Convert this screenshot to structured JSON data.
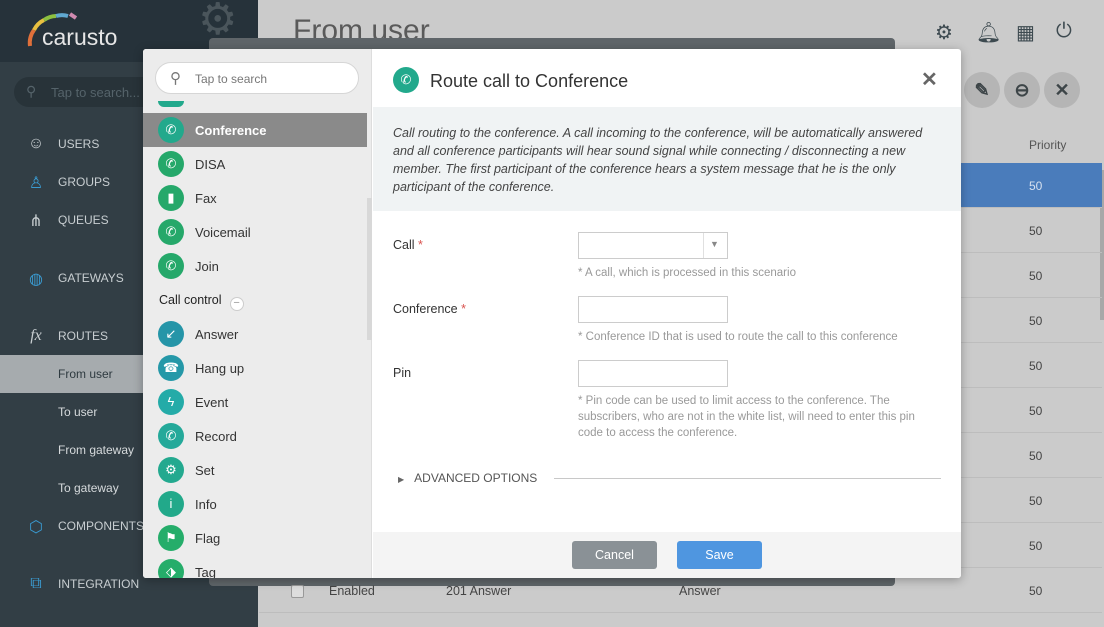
{
  "sidebar": {
    "logo": "carusto",
    "search_placeholder": "Tap to search...",
    "items": [
      {
        "label": "USERS",
        "icon": "user-icon"
      },
      {
        "label": "GROUPS",
        "icon": "groups-icon"
      },
      {
        "label": "QUEUES",
        "icon": "queues-icon"
      },
      {
        "label": "GATEWAYS",
        "icon": "globe-icon"
      },
      {
        "label": "ROUTES",
        "icon": "fx-icon"
      },
      {
        "label": "From user"
      },
      {
        "label": "To user"
      },
      {
        "label": "From gateway"
      },
      {
        "label": "To gateway"
      },
      {
        "label": "COMPONENTS",
        "icon": "cube-icon"
      },
      {
        "label": "INTEGRATION",
        "icon": "integration-icon"
      }
    ]
  },
  "header": {
    "title": "From user"
  },
  "table": {
    "priority_header": "Priority",
    "priorities": [
      "50",
      "50",
      "50",
      "50",
      "50",
      "50",
      "50",
      "50",
      "50",
      "50"
    ],
    "last_row": {
      "status": "Enabled",
      "name": "201 Answer",
      "action": "Answer"
    }
  },
  "modal": {
    "search_placeholder": "Tap to search",
    "list": [
      {
        "label": "Conference",
        "color": "#22a98c"
      },
      {
        "label": "DISA",
        "color": "#25a86a"
      },
      {
        "label": "Fax",
        "color": "#25a86a"
      },
      {
        "label": "Voicemail",
        "color": "#25a86a"
      },
      {
        "label": "Join",
        "color": "#25a86a"
      }
    ],
    "group_label": "Call control",
    "list2": [
      {
        "label": "Answer",
        "color": "#2595a8"
      },
      {
        "label": "Hang up",
        "color": "#2598a8"
      },
      {
        "label": "Event",
        "color": "#24aba8"
      },
      {
        "label": "Record",
        "color": "#24a99a"
      },
      {
        "label": "Set",
        "color": "#23a98f"
      },
      {
        "label": "Info",
        "color": "#22a98a"
      },
      {
        "label": "Flag",
        "color": "#25ad6a"
      },
      {
        "label": "Tag",
        "color": "#25ad6a"
      }
    ],
    "title": "Route call to Conference",
    "description": "Call routing to the conference. A call incoming to the conference, will be automatically answered and all conference participants will hear sound signal while connecting / disconnecting a new member. The first participant of the conference hears a system message that he is the only participant of the conference.",
    "fields": [
      {
        "label": "Call",
        "required": "*",
        "value": "",
        "help": "* A call, which is processed in this scenario"
      },
      {
        "label": "Conference",
        "required": "*",
        "value": "",
        "help": "* Conference ID that is used to route the call to this conference"
      },
      {
        "label": "Pin",
        "required": "",
        "value": "",
        "help": "* Pin code can be used to limit access to the conference. The subscribers, who are not in the white list, will need to enter this pin code to access the conference."
      }
    ],
    "advanced": "ADVANCED OPTIONS",
    "cancel": "Cancel",
    "save": "Save"
  }
}
